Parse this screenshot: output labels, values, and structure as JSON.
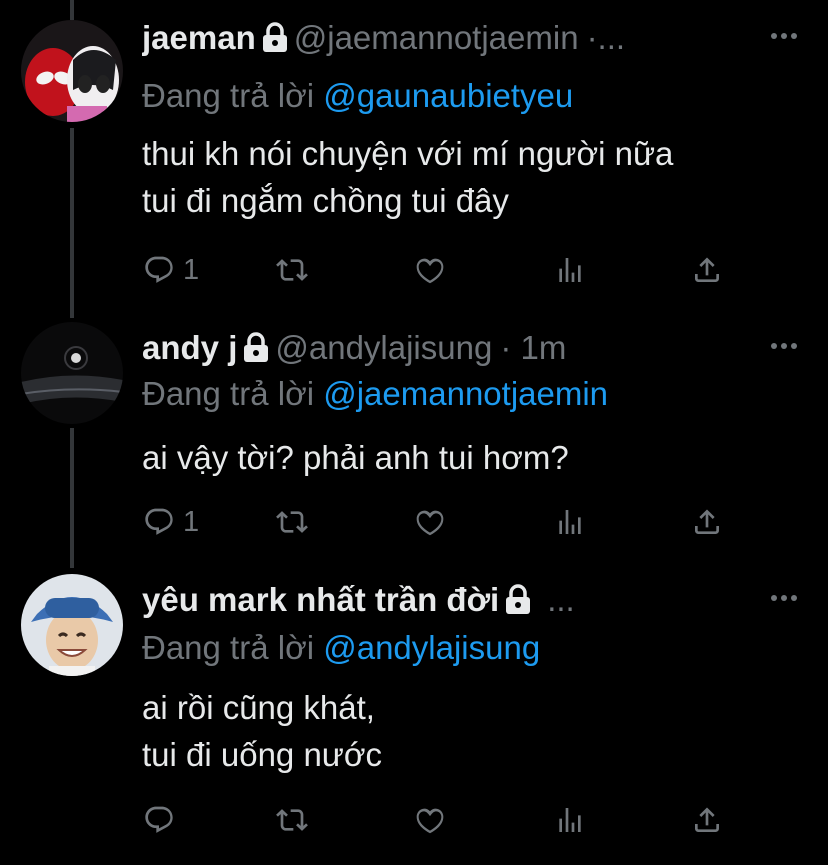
{
  "tweets": [
    {
      "name": "jaeman",
      "handle": "@jaemannotjaemin",
      "meta": "·...",
      "reply_label": "Đang trả lời",
      "reply_to": "@gaunaubietyeu",
      "text": "thui kh nói chuyện với mí người nữa\ntui đi ngắm chồng tui đây",
      "reply_count": "1",
      "avatar": "spiderman-pair-avatar"
    },
    {
      "name": "andy j",
      "handle": "@andylajisung",
      "meta": "· 1m",
      "reply_label": "Đang trả lời",
      "reply_to": "@jaemannotjaemin",
      "text": "ai vậy tời? phải anh tui hơm?",
      "reply_count": "1",
      "avatar": "dark-room-avatar"
    },
    {
      "name": "yêu mark nhất trần đời",
      "handle": "",
      "meta": "...",
      "reply_label": "Đang trả lời",
      "reply_to": "@andylajisung",
      "text": "ai rồi cũng khát,\ntui đi uống nước",
      "reply_count": "",
      "avatar": "bucket-hat-avatar"
    }
  ],
  "icons": {
    "reply": "reply-icon",
    "retweet": "retweet-icon",
    "like": "heart-icon",
    "views": "views-icon",
    "share": "share-icon",
    "lock": "lock-icon",
    "more": "more-dots-icon"
  },
  "colors": {
    "background": "#000000",
    "text": "#e7e9ea",
    "muted": "#71767b",
    "mention": "#1d9bf0",
    "thread_line": "#333639"
  }
}
